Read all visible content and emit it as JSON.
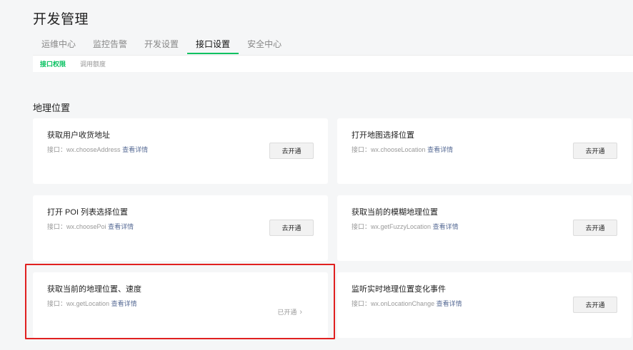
{
  "header": {
    "title": "开发管理"
  },
  "tabs": [
    {
      "label": "运维中心"
    },
    {
      "label": "监控告警"
    },
    {
      "label": "开发设置"
    },
    {
      "label": "接口设置",
      "active": true
    },
    {
      "label": "安全中心"
    }
  ],
  "subtabs": [
    {
      "label": "接口权限",
      "active": true
    },
    {
      "label": "调用额度"
    }
  ],
  "section": {
    "title": "地理位置"
  },
  "cards": [
    {
      "title": "获取用户收货地址",
      "desc_prefix": "接口：",
      "api": "wx.chooseAddress",
      "link": "查看详情",
      "action": "去开通"
    },
    {
      "title": "打开地图选择位置",
      "desc_prefix": "接口：",
      "api": "wx.chooseLocation",
      "link": "查看详情",
      "action": "去开通"
    },
    {
      "title": "打开 POI 列表选择位置",
      "desc_prefix": "接口：",
      "api": "wx.choosePoi",
      "link": "查看详情",
      "action": "去开通"
    },
    {
      "title": "获取当前的模糊地理位置",
      "desc_prefix": "接口：",
      "api": "wx.getFuzzyLocation",
      "link": "查看详情",
      "action": "去开通"
    },
    {
      "title": "获取当前的地理位置、速度",
      "desc_prefix": "接口：",
      "api": "wx.getLocation",
      "link": "查看详情",
      "status": "已开通"
    },
    {
      "title": "监听实时地理位置变化事件",
      "desc_prefix": "接口：",
      "api": "wx.onLocationChange",
      "link": "查看详情",
      "action": "去开通"
    }
  ],
  "colors": {
    "accent": "#07c160",
    "link": "#576b95",
    "highlight": "#e02020",
    "background": "#f5f6f7"
  }
}
